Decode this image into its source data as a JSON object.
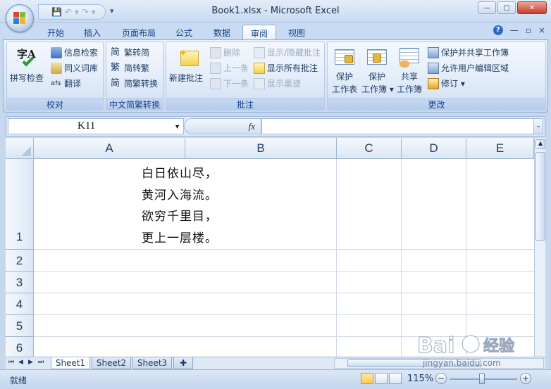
{
  "window": {
    "title": "Book1.xlsx - Microsoft Excel",
    "close": "✕",
    "maximize": "▢",
    "minimize": "—"
  },
  "qat": {
    "save": "💾",
    "undo": "↶ ▾",
    "redo": "↷ ▾",
    "more": "▾"
  },
  "tabs": [
    {
      "label": "开始"
    },
    {
      "label": "插入"
    },
    {
      "label": "页面布局"
    },
    {
      "label": "公式"
    },
    {
      "label": "数据"
    },
    {
      "label": "审阅"
    },
    {
      "label": "视图"
    }
  ],
  "tab_right": {
    "help": "?",
    "minimize": "—",
    "restore": "▫",
    "close": "×"
  },
  "ribbon": {
    "proofing": {
      "label": "校对",
      "spell": "拼写检查",
      "spell_icon_text": "字A",
      "research": "信息检索",
      "thesaurus": "同义词库",
      "translate": "翻译"
    },
    "chinese": {
      "label": "中文简繁转换",
      "to_simplified": "繁转简",
      "to_traditional": "简转繁",
      "convert": "简繁转换"
    },
    "comments": {
      "label": "批注",
      "new": "新建批注",
      "delete": "删除",
      "previous": "上一条",
      "next": "下一条",
      "show_hide": "显示/隐藏批注",
      "show_all": "显示所有批注",
      "show_ink": "显示墨迹"
    },
    "changes": {
      "label": "更改",
      "protect_sheet_1": "保护",
      "protect_sheet_2": "工作表",
      "protect_workbook_1": "保护",
      "protect_workbook_2": "工作簿 ▾",
      "share_workbook_1": "共享",
      "share_workbook_2": "工作簿",
      "protect_share": "保护并共享工作簿",
      "allow_edit": "允许用户编辑区域",
      "track": "修订 ▾"
    }
  },
  "formula_bar": {
    "name_box": "K11",
    "fx": "fx",
    "formula": ""
  },
  "columns": [
    "A",
    "B",
    "C",
    "D",
    "E"
  ],
  "rows": [
    "1",
    "2",
    "3",
    "4",
    "5",
    "6"
  ],
  "cell_text": {
    "line1": "白日依山尽，",
    "line2": "黄河入海流。",
    "line3": "欲穷千里目，",
    "line4": "更上一层楼。"
  },
  "sheets": [
    {
      "label": "Sheet1"
    },
    {
      "label": "Sheet2"
    },
    {
      "label": "Sheet3"
    }
  ],
  "status": {
    "ready": "就绪",
    "zoom": "115%",
    "zoom_minus": "−",
    "zoom_plus": "+"
  },
  "watermark": {
    "brand": "Bai",
    "brand2": "经验",
    "url": "jingyan.baidu.com"
  },
  "colors": {
    "accent": "#15428b",
    "ribbon": "#d6e4f6",
    "grid_line": "#d0d7e5"
  }
}
